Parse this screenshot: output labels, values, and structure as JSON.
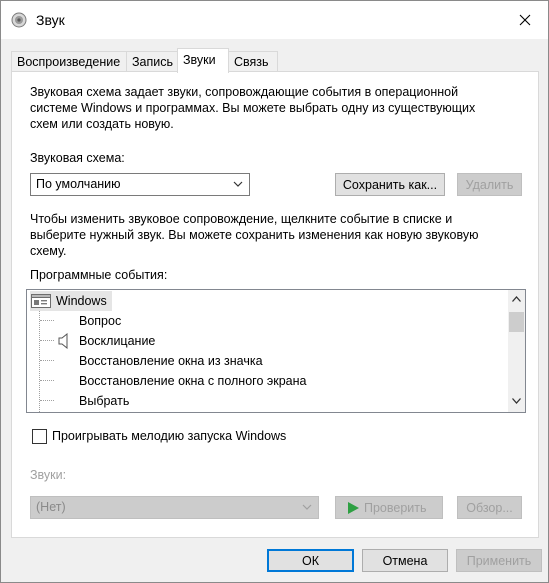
{
  "window": {
    "title": "Звук",
    "icon": "speaker-icon"
  },
  "tabs": [
    {
      "label": "Воспроизведение"
    },
    {
      "label": "Запись"
    },
    {
      "label": "Звуки"
    },
    {
      "label": "Связь"
    }
  ],
  "panel": {
    "description": "Звуковая схема задает звуки, сопровождающие события в операционной системе Windows и программах. Вы можете выбрать одну из существующих схем или создать новую.",
    "scheme_label": "Звуковая схема:",
    "scheme_value": "По умолчанию",
    "save_as_label": "Сохранить как...",
    "delete_label": "Удалить",
    "instructions": "Чтобы изменить звуковое сопровождение, щелкните событие в списке и выберите нужный звук. Вы можете сохранить изменения как новую звуковую схему.",
    "events_label": "Программные события:",
    "events": [
      {
        "label": "Windows",
        "type": "root",
        "icon": "windows-folder-icon"
      },
      {
        "label": "Вопрос",
        "type": "child",
        "has_sound": false
      },
      {
        "label": "Восклицание",
        "type": "child",
        "has_sound": true
      },
      {
        "label": "Восстановление окна из значка",
        "type": "child",
        "has_sound": false
      },
      {
        "label": "Восстановление окна с полного экрана",
        "type": "child",
        "has_sound": false
      },
      {
        "label": "Выбрать",
        "type": "child",
        "has_sound": false
      }
    ],
    "play_startup_label": "Проигрывать мелодию запуска Windows",
    "play_startup_checked": false,
    "sounds_label": "Звуки:",
    "sounds_value": "(Нет)",
    "test_label": "Проверить",
    "browse_label": "Обзор..."
  },
  "footer": {
    "ok_label": "ОК",
    "cancel_label": "Отмена",
    "apply_label": "Применить"
  },
  "colors": {
    "accent": "#0078d7",
    "disabled_text": "#a0a0a0",
    "play_green": "#2ea043"
  }
}
